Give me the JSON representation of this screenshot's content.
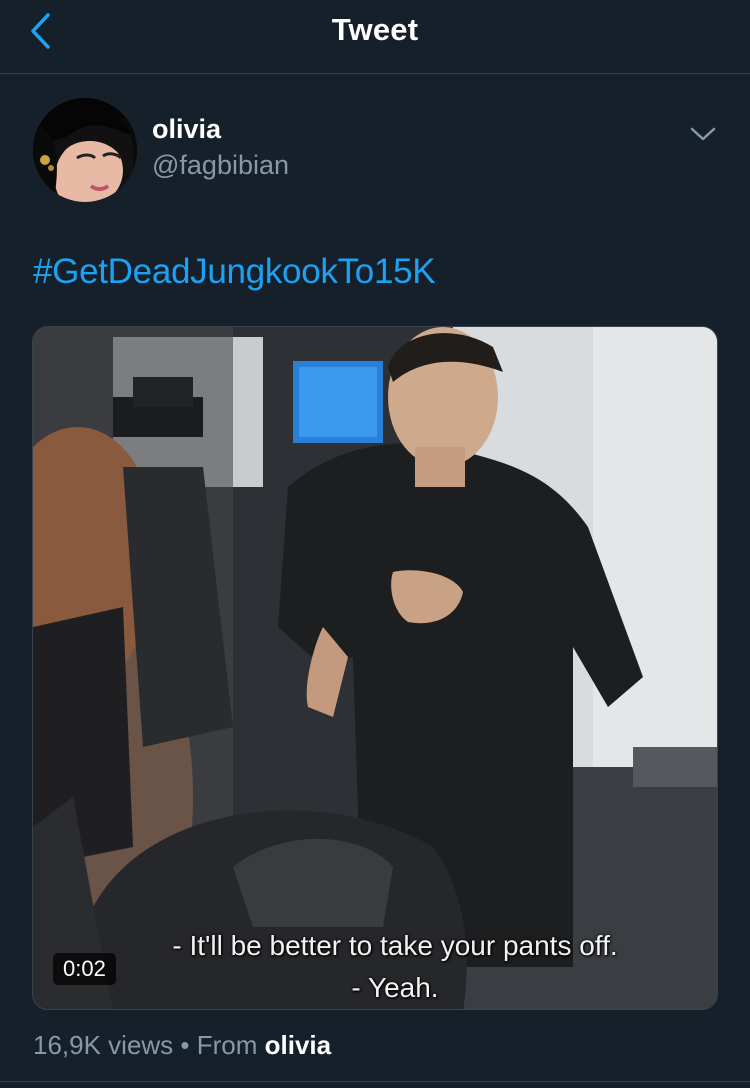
{
  "header": {
    "title": "Tweet"
  },
  "author": {
    "name": "olivia",
    "handle": "@fagbibian"
  },
  "tweet": {
    "text": "#GetDeadJungkookTo15K"
  },
  "media": {
    "duration": "0:02",
    "subtitle_line1": "- It'll be better to take your pants off.",
    "subtitle_line2": "- Yeah."
  },
  "stats": {
    "views": "16,9K views",
    "separator": " • ",
    "from_label": "From ",
    "source_name": "olivia"
  },
  "colors": {
    "background": "#15202b",
    "accent": "#1da1f2",
    "secondary_text": "#8899a6",
    "divider": "#38444d"
  },
  "icons": {
    "back": "chevron-left-icon",
    "more": "chevron-down-icon"
  }
}
